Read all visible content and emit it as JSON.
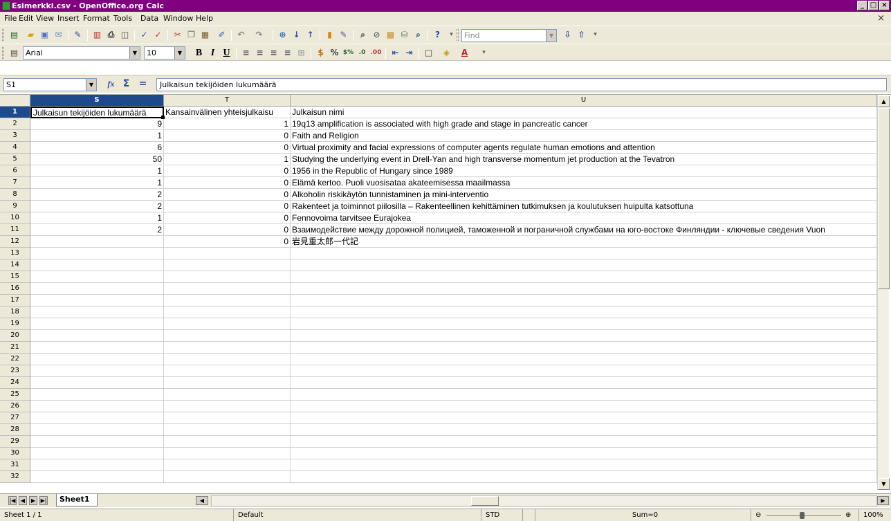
{
  "window": {
    "title": "Esimerkki.csv - OpenOffice.org Calc",
    "buttons": [
      "_",
      "□",
      "×"
    ]
  },
  "menubar": {
    "items": [
      "File",
      "Edit",
      "View",
      "Insert",
      "Format",
      "Tools",
      "Data",
      "Window",
      "Help"
    ]
  },
  "toolbar": {
    "find_placeholder": "Find"
  },
  "formatting": {
    "font_name": "Arial",
    "font_size": "10",
    "bold": "B",
    "italic": "I",
    "underline": "U"
  },
  "formula_bar": {
    "name_box": "S1",
    "content": "Julkaisun tekijöiden lukumäärä"
  },
  "grid": {
    "columns": [
      "S",
      "T",
      "U"
    ],
    "selected_column": "S",
    "rows": [
      {
        "n": "1",
        "s": "Julkaisun tekijöiden lukumäärä",
        "t": "Kansainvälinen yhteisjulkaisu",
        "u": "Julkaisun nimi"
      },
      {
        "n": "2",
        "s": "9",
        "t": "1",
        "u": "19q13 amplification is associated with high grade and stage in pancreatic cancer"
      },
      {
        "n": "3",
        "s": "1",
        "t": "0",
        "u": "Faith and Religion"
      },
      {
        "n": "4",
        "s": "6",
        "t": "0",
        "u": "Virtual proximity and facial expressions of computer agents regulate human emotions and attention"
      },
      {
        "n": "5",
        "s": "50",
        "t": "1",
        "u": "Studying the underlying event in Drell-Yan and high transverse momentum jet production at the Tevatron"
      },
      {
        "n": "6",
        "s": "1",
        "t": "0",
        "u": "1956 in the Republic of Hungary since 1989"
      },
      {
        "n": "7",
        "s": "1",
        "t": "0",
        "u": "Elämä kertoo. Puoli vuosisataa akateemisessa maailmassa"
      },
      {
        "n": "8",
        "s": "2",
        "t": "0",
        "u": "Alkoholin riskikäytön tunnistaminen ja mini-interventio"
      },
      {
        "n": "9",
        "s": "2",
        "t": "0",
        "u": "Rakenteet ja toiminnot piilosilla – Rakenteellinen kehittäminen tutkimuksen ja koulutuksen huipulta katsottuna"
      },
      {
        "n": "10",
        "s": "1",
        "t": "0",
        "u": "Fennovoima tarvitsee Eurajokea"
      },
      {
        "n": "11",
        "s": "2",
        "t": "0",
        "u": "Взаимодействие между дорожной полицией, таможенной и пограничной службами на юго-востоке Финляндии - ключевые сведения Vuon"
      },
      {
        "n": "12",
        "s": "",
        "t": "0",
        "u": "岩見重太郎一代記"
      },
      {
        "n": "13",
        "s": "",
        "t": "",
        "u": ""
      },
      {
        "n": "14",
        "s": "",
        "t": "",
        "u": ""
      },
      {
        "n": "15",
        "s": "",
        "t": "",
        "u": ""
      },
      {
        "n": "16",
        "s": "",
        "t": "",
        "u": ""
      },
      {
        "n": "17",
        "s": "",
        "t": "",
        "u": ""
      },
      {
        "n": "18",
        "s": "",
        "t": "",
        "u": ""
      },
      {
        "n": "19",
        "s": "",
        "t": "",
        "u": ""
      },
      {
        "n": "20",
        "s": "",
        "t": "",
        "u": ""
      },
      {
        "n": "21",
        "s": "",
        "t": "",
        "u": ""
      },
      {
        "n": "22",
        "s": "",
        "t": "",
        "u": ""
      },
      {
        "n": "23",
        "s": "",
        "t": "",
        "u": ""
      },
      {
        "n": "24",
        "s": "",
        "t": "",
        "u": ""
      },
      {
        "n": "25",
        "s": "",
        "t": "",
        "u": ""
      },
      {
        "n": "26",
        "s": "",
        "t": "",
        "u": ""
      },
      {
        "n": "27",
        "s": "",
        "t": "",
        "u": ""
      },
      {
        "n": "28",
        "s": "",
        "t": "",
        "u": ""
      },
      {
        "n": "29",
        "s": "",
        "t": "",
        "u": ""
      },
      {
        "n": "30",
        "s": "",
        "t": "",
        "u": ""
      },
      {
        "n": "31",
        "s": "",
        "t": "",
        "u": ""
      },
      {
        "n": "32",
        "s": "",
        "t": "",
        "u": ""
      }
    ]
  },
  "sheet_tabs": [
    "Sheet1"
  ],
  "statusbar": {
    "sheet": "Sheet 1 / 1",
    "style": "Default",
    "mode": "STD",
    "sum": "Sum=0",
    "zoom": "100%"
  },
  "colors": {
    "titlebar": "#800080",
    "selection_header": "#1e4a8c",
    "chrome": "#ece9d8"
  }
}
